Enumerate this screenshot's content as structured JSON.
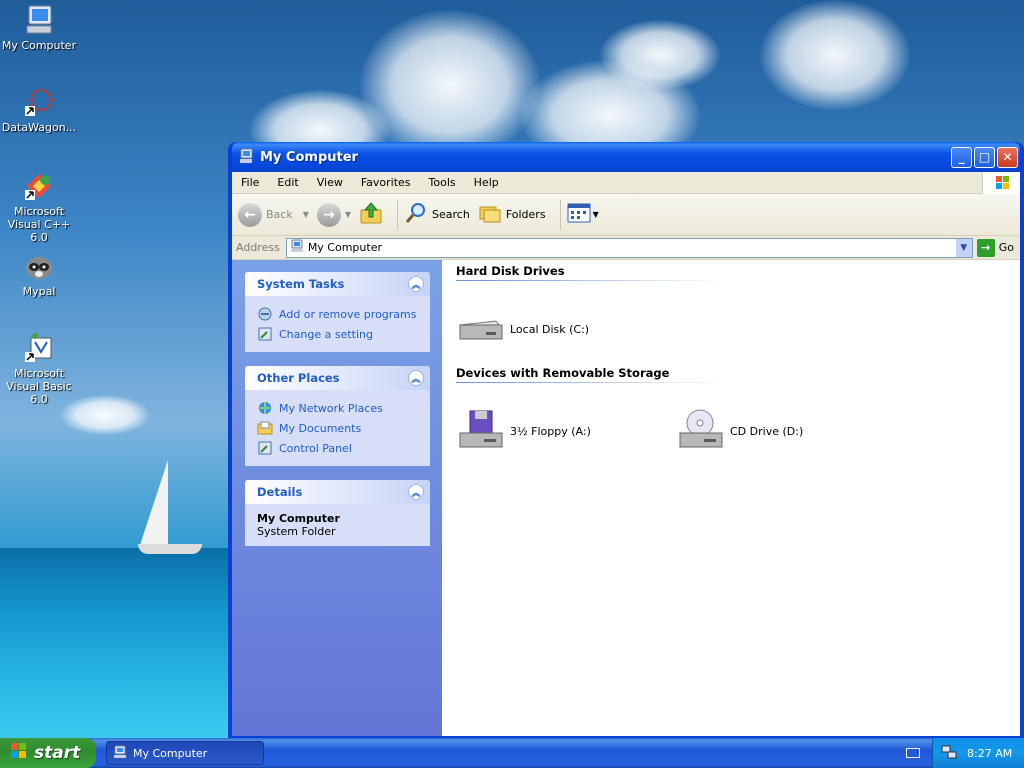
{
  "desktop": {
    "icons": [
      {
        "label": "My Computer"
      },
      {
        "label": "DataWagon..."
      },
      {
        "label": "Microsoft Visual C++ 6.0"
      },
      {
        "label": "Mypal"
      },
      {
        "label": "Microsoft Visual Basic 6.0"
      }
    ]
  },
  "window": {
    "title": "My Computer",
    "menu": [
      "File",
      "Edit",
      "View",
      "Favorites",
      "Tools",
      "Help"
    ],
    "toolbar": {
      "back": "Back",
      "search": "Search",
      "folders": "Folders"
    },
    "address": {
      "label": "Address",
      "value": "My Computer",
      "go": "Go"
    },
    "tasks": {
      "system": {
        "title": "System Tasks",
        "items": [
          "Add or remove programs",
          "Change a setting"
        ]
      },
      "places": {
        "title": "Other Places",
        "items": [
          "My Network Places",
          "My Documents",
          "Control Panel"
        ]
      },
      "details": {
        "title": "Details",
        "name": "My Computer",
        "type": "System Folder"
      }
    },
    "groups": {
      "hdd": {
        "title": "Hard Disk Drives",
        "items": [
          "Local Disk (C:)"
        ]
      },
      "removable": {
        "title": "Devices with Removable Storage",
        "items": [
          "3½ Floppy (A:)",
          "CD Drive (D:)"
        ]
      }
    }
  },
  "taskbar": {
    "start": "start",
    "task": "My Computer",
    "clock": "8:27 AM"
  },
  "colors": {
    "accent": "#0a3fd4",
    "link": "#215dc6",
    "start": "#3c9a3c"
  }
}
